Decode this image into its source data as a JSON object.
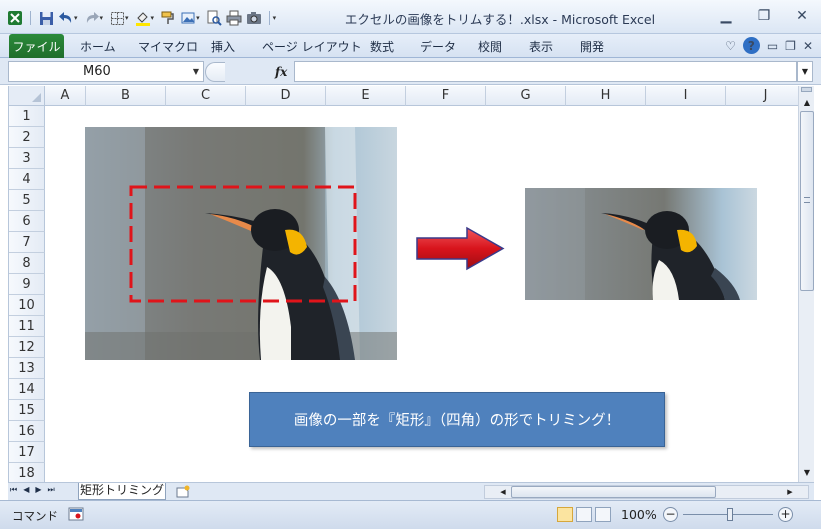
{
  "window": {
    "title": "エクセルの画像をトリムする！.xlsx - Microsoft Excel",
    "minimize_icon": "minimize-icon",
    "restore_icon": "restore-icon",
    "close_icon": "close-icon"
  },
  "ribbon": {
    "file_tab": "ファイル",
    "tabs": [
      "ホーム",
      "マイマクロ",
      "挿入",
      "ページ レイアウト",
      "数式",
      "データ",
      "校閲",
      "表示",
      "開発"
    ]
  },
  "formula_bar": {
    "name_box": "M60",
    "fx_label": "fx",
    "formula": ""
  },
  "grid": {
    "columns": [
      "A",
      "B",
      "C",
      "D",
      "E",
      "F",
      "G",
      "H",
      "I",
      "J"
    ],
    "rows": [
      "1",
      "2",
      "3",
      "4",
      "5",
      "6",
      "7",
      "8",
      "9",
      "10",
      "11",
      "12",
      "13",
      "14",
      "15",
      "16",
      "17",
      "18"
    ]
  },
  "callout": {
    "text": "画像の一部を『矩形』（四角）の形でトリミング！"
  },
  "sheets": {
    "active": "矩形トリミング"
  },
  "status_bar": {
    "mode": "コマンド",
    "zoom": "100%",
    "zoom_minus": "−",
    "zoom_plus": "+"
  },
  "colors": {
    "accent": "#4f81bd",
    "file_tab": "#217346",
    "trim_border": "#e0141a",
    "arrow": "#d8141c"
  }
}
